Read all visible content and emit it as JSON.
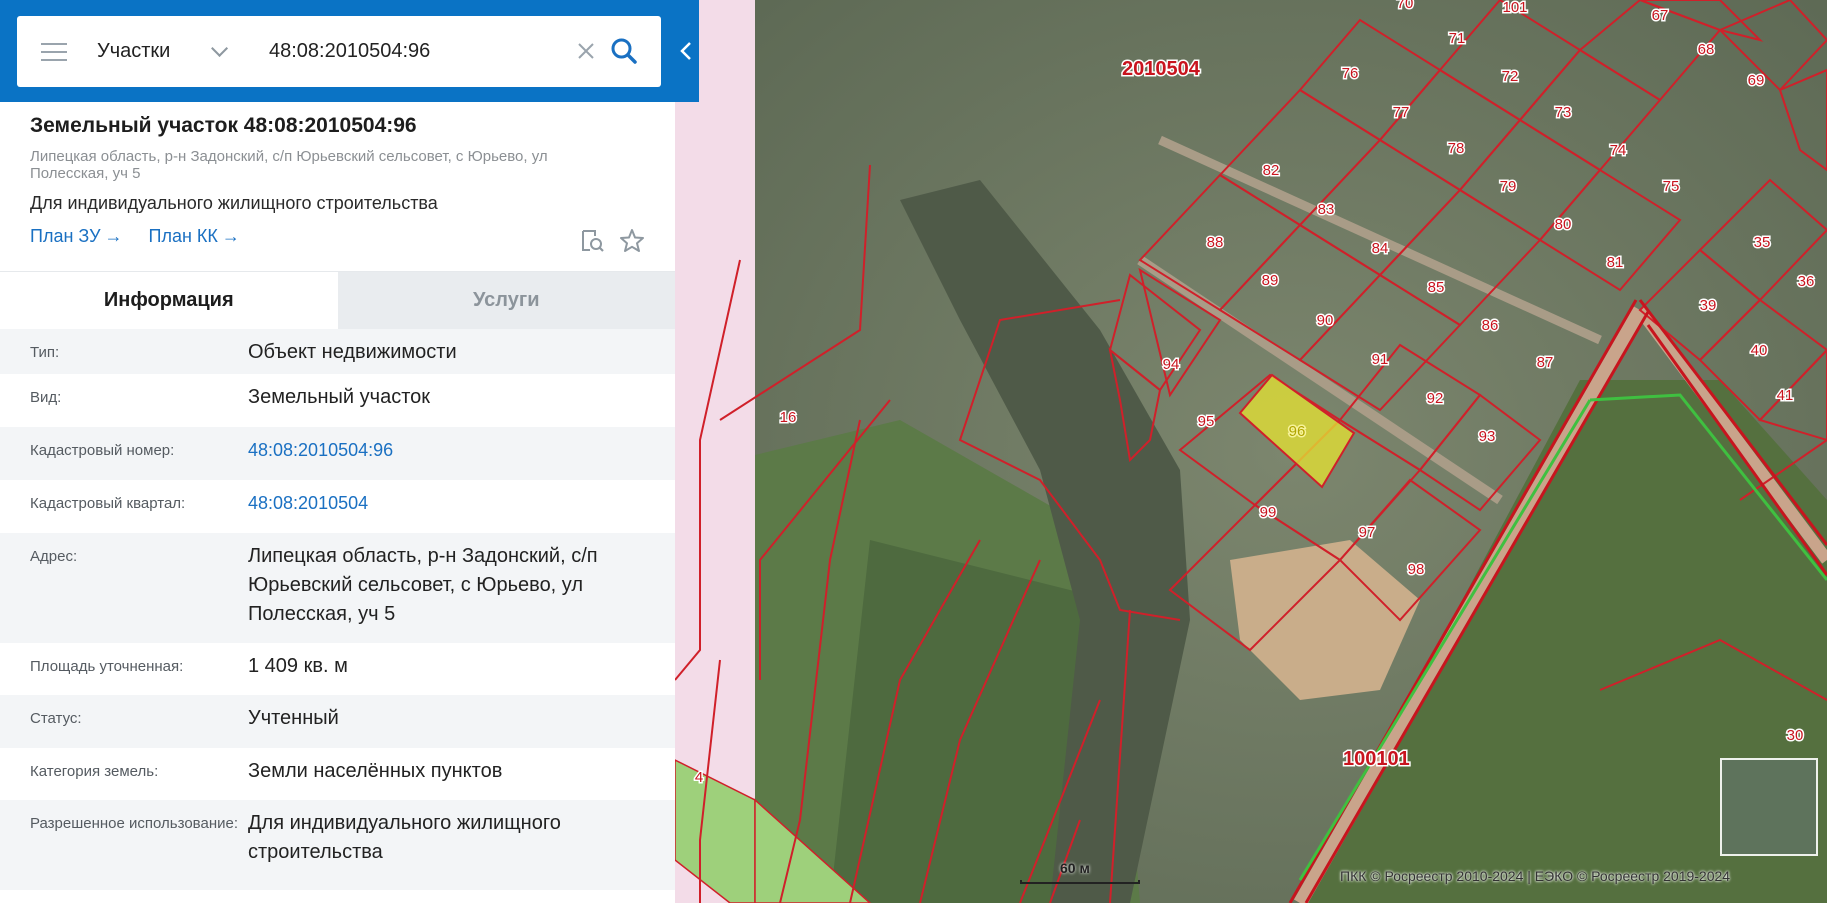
{
  "search": {
    "type_label": "Участки",
    "value": "48:08:2010504:96"
  },
  "card": {
    "title": "Земельный участок 48:08:2010504:96",
    "address": "Липецкая область, р-н Задонский, с/п Юрьевский сельсовет, с Юрьево, ул Полесская, уч 5",
    "purpose": "Для индивидуального жилищного строительства",
    "plan_zu": "План ЗУ",
    "plan_kk": "План КК",
    "arrow": "→"
  },
  "tabs": [
    {
      "label": "Информация"
    },
    {
      "label": "Услуги"
    }
  ],
  "info": [
    {
      "label": "Тип:",
      "value": "Объект недвижимости"
    },
    {
      "label": "Вид:",
      "value": "Земельный участок"
    },
    {
      "label": "Кадастровый номер:",
      "value": "48:08:2010504:96"
    },
    {
      "label": "Кадастровый квартал:",
      "value": "48:08:2010504"
    },
    {
      "label": "Адрес:",
      "value": "Липецкая область, р-н Задонский, с/п Юрьевский сельсовет, с Юрьево, ул Полесская, уч 5"
    },
    {
      "label": "Площадь уточненная:",
      "value": "1 409 кв. м"
    },
    {
      "label": "Статус:",
      "value": "Учтенный"
    },
    {
      "label": "Категория земель:",
      "value": "Земли населённых пунктов"
    },
    {
      "label": "Разрешенное использование:",
      "value": "Для индивидуального жилищного строительства"
    }
  ],
  "map": {
    "quarter_labels": [
      "2010504",
      "100101"
    ],
    "parcel_labels": [
      "70",
      "101",
      "67",
      "71",
      "68",
      "69",
      "76",
      "72",
      "77",
      "73",
      "78",
      "74",
      "82",
      "79",
      "75",
      "83",
      "80",
      "88",
      "84",
      "81",
      "35",
      "89",
      "85",
      "36",
      "90",
      "86",
      "39",
      "94",
      "91",
      "87",
      "40",
      "41",
      "95",
      "92",
      "96",
      "93",
      "99",
      "97",
      "98",
      "16",
      "30",
      "4"
    ],
    "scale_label": "60 м",
    "attribution": "ПКК © Росреестр 2010-2024 | ЕЭКО © Росреестр 2019-2024"
  },
  "colors": {
    "header_blue": "#0a73c5",
    "link_blue": "#1a70c2",
    "parcel_red": "#d0202a",
    "selected_parcel": "#e3e033"
  }
}
